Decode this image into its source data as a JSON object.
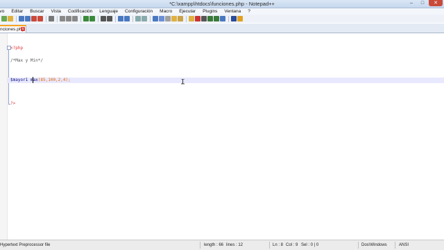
{
  "window": {
    "title": "*C:\\xampp\\htdocs\\funciones.php - Notepad++",
    "minimize": "–",
    "maximize": "□",
    "close": "✕"
  },
  "menu": [
    "ivo",
    "Editar",
    "Buscar",
    "Vista",
    "Codificación",
    "Lenguaje",
    "Configuración",
    "Macro",
    "Ejecutar",
    "Plugins",
    "Ventana",
    "?"
  ],
  "tab": {
    "label": "nciones.php",
    "close": "x"
  },
  "code": {
    "line1": "<?php",
    "line2": "/*Max y Min*/",
    "line3_var": "$mayor1",
    "line3_fn": "max",
    "line3_args": "(85,100,2,4);",
    "line4": "?>"
  },
  "status": {
    "lang": "Hypertext Preprocessor file",
    "length": "length : 66",
    "lines": "lines : 12",
    "ln": "Ln : 8",
    "col": "Col : 9",
    "sel": "Sel : 0 | 0",
    "eol": "Dos\\Windows",
    "encoding": "ANSI"
  },
  "toolbar_icons": [
    "new-icon",
    "open-icon",
    "save-icon",
    "save-all-icon",
    "close-icon",
    "close-all-icon",
    "print-icon",
    "cut-icon",
    "copy-icon",
    "paste-icon",
    "undo-icon",
    "redo-icon",
    "find-icon",
    "replace-icon",
    "zoom-in-icon",
    "zoom-out-icon",
    "sync-v-icon",
    "sync-h-icon",
    "wrap-icon",
    "all-chars-icon",
    "indent-guide-icon",
    "doc-map-icon",
    "func-list-icon",
    "folder-icon",
    "record-icon",
    "stop-icon",
    "play-icon",
    "play-multi-icon",
    "save-macro-icon",
    "spellcheck-icon",
    "spellcheck2-icon"
  ]
}
